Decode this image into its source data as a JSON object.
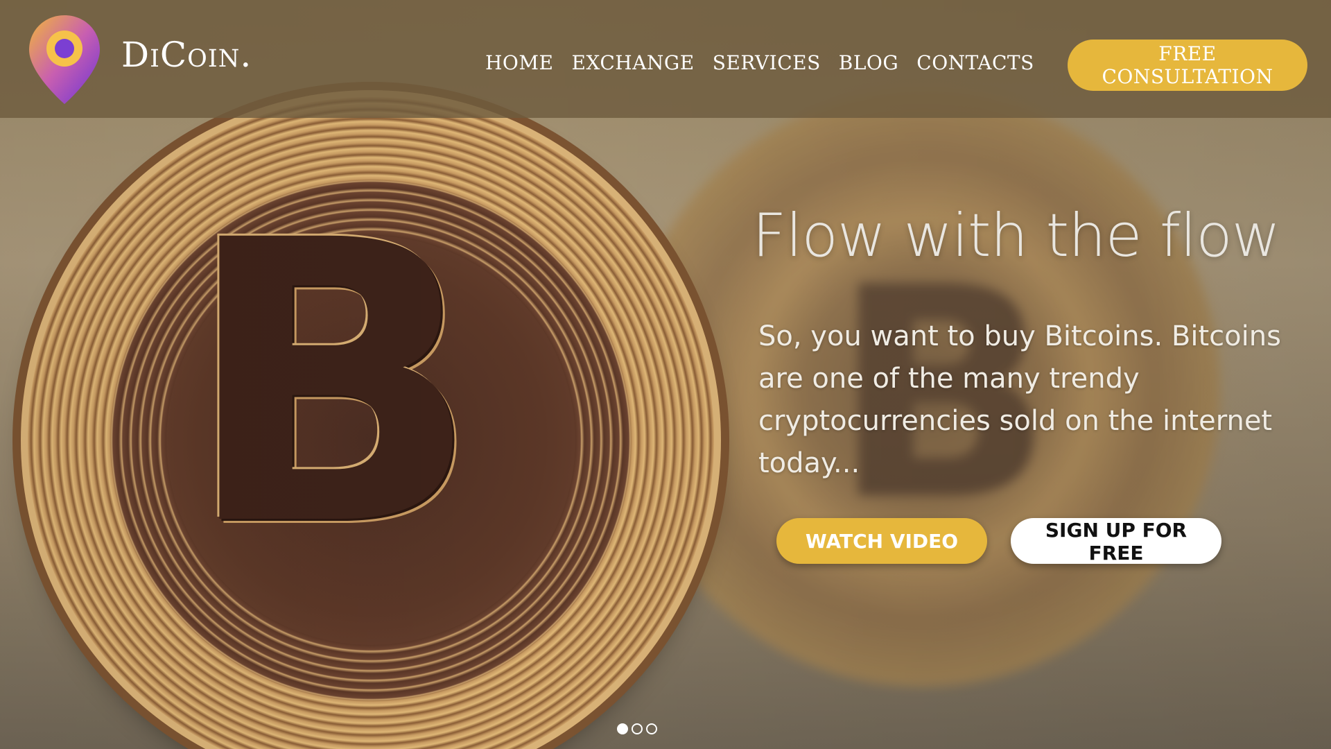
{
  "brand": {
    "name": "DiCoin."
  },
  "nav": {
    "items": [
      "HOME",
      "EXCHANGE",
      "SERVICES",
      "BLOG",
      "CONTACTS"
    ]
  },
  "header": {
    "cta_label": "FREE CONSULTATION"
  },
  "hero": {
    "headline": "Flow with the flow",
    "subtext": "So, you want to buy Bitcoins. Bitcoins are one of the many trendy cryptocurrencies sold on the internet today...",
    "watch_label": "WATCH VIDEO",
    "signup_label": "SIGN UP FOR FREE"
  },
  "slider": {
    "total": 3,
    "active": 1
  },
  "colors": {
    "accent": "#e6b73c",
    "header_bg": "#6e5c3e",
    "logo_purple": "#8a3fd6",
    "logo_orange": "#f0b23a"
  }
}
